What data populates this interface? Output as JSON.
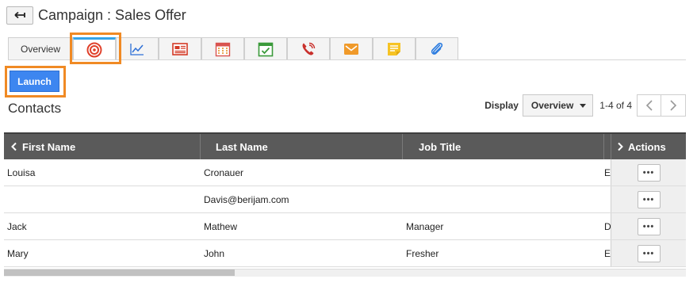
{
  "header": {
    "title": "Campaign : Sales Offer"
  },
  "tabs": [
    {
      "label": "Overview",
      "icon": null
    },
    {
      "label": "",
      "icon": "target-icon"
    },
    {
      "label": "",
      "icon": "chart-line-icon"
    },
    {
      "label": "",
      "icon": "newspaper-icon"
    },
    {
      "label": "",
      "icon": "calendar-icon"
    },
    {
      "label": "",
      "icon": "calendar-check-icon"
    },
    {
      "label": "",
      "icon": "phone-icon"
    },
    {
      "label": "",
      "icon": "envelope-icon"
    },
    {
      "label": "",
      "icon": "note-icon"
    },
    {
      "label": "",
      "icon": "paperclip-icon"
    }
  ],
  "launch_label": "Launch",
  "contacts_title": "Contacts",
  "display": {
    "label": "Display",
    "selected": "Overview",
    "range": "1-4 of 4"
  },
  "table": {
    "headers": {
      "first_name": "First Name",
      "last_name": "Last Name",
      "job_title": "Job Title",
      "actions": "Actions"
    },
    "rows": [
      {
        "first_name": "Louisa",
        "last_name": "Cronauer",
        "job_title": "",
        "extra": "E"
      },
      {
        "first_name": "",
        "last_name": "Davis@berijam.com",
        "job_title": "",
        "extra": ""
      },
      {
        "first_name": "Jack",
        "last_name": "Mathew",
        "job_title": "Manager",
        "extra": "D"
      },
      {
        "first_name": "Mary",
        "last_name": "John",
        "job_title": "Fresher",
        "extra": "E"
      }
    ],
    "row_action_label": "•••"
  },
  "colors": {
    "accent": "#f08a24",
    "primary": "#3d86f0",
    "active_tab": "#36a4e8",
    "header_bg": "#5a5a5a"
  }
}
